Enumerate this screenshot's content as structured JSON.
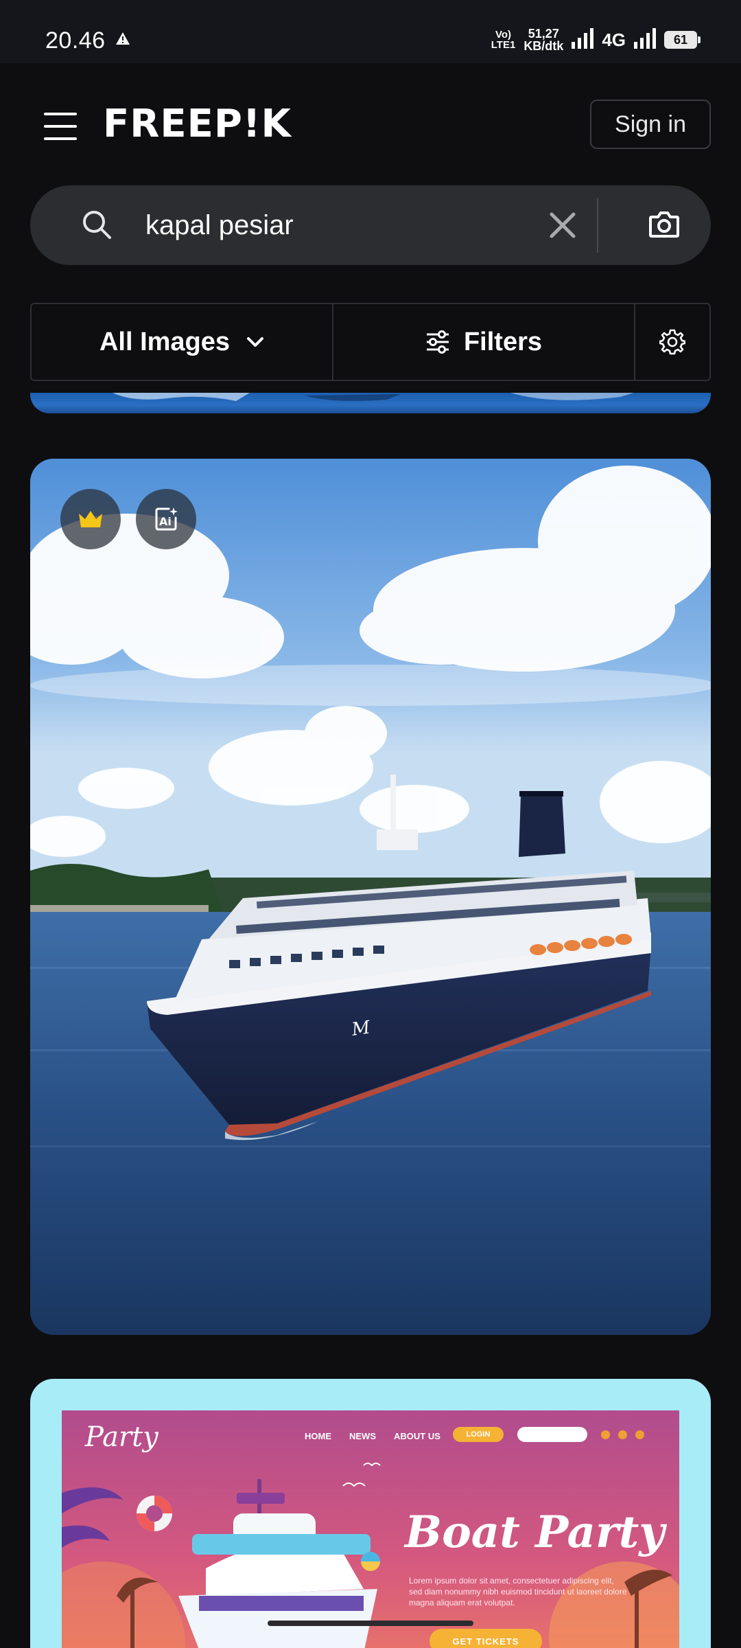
{
  "status_bar": {
    "time": "20.46",
    "volte": "Vo)",
    "lte": "LTE1",
    "speed_value": "51,27",
    "speed_unit": "KB/dtk",
    "network": "4G",
    "battery": "61"
  },
  "header": {
    "logo": "FREEP!K",
    "sign_in_label": "Sign in"
  },
  "search": {
    "value": "kapal pesiar"
  },
  "filters": {
    "type_label": "All Images",
    "filters_label": "Filters"
  },
  "poster": {
    "brand": "Party",
    "nav": [
      "HOME",
      "NEWS",
      "ABOUT US"
    ],
    "login_label": "LOGIN",
    "title": "Boat Party",
    "body": "Lorem ipsum dolor sit amet, consectetuer adipiscing elit, sed diam nonummy nibh euismod tincidunt ut laoreet dolore magna aliquam erat volutpat.",
    "cta_label": "GET TICKETS"
  },
  "colors": {
    "background": "#0e0e10",
    "search_bg": "#2c2d31",
    "premium_crown": "#f5c518",
    "card2_bg": "#a8ecf7"
  }
}
